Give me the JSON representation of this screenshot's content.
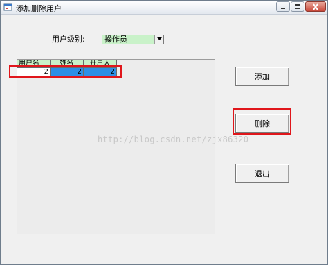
{
  "window": {
    "title": "添加删除用户"
  },
  "form": {
    "level_label": "用户级别:",
    "level_value": "操作员"
  },
  "grid": {
    "columns": [
      "用户名",
      "姓名",
      "开户人"
    ],
    "rows": [
      [
        "2",
        "2",
        "2"
      ]
    ]
  },
  "buttons": {
    "add": "添加",
    "delete": "删除",
    "exit": "退出"
  },
  "watermark": "http://blog.csdn.net/zjx86320",
  "colors": {
    "header_bg": "#c9f2c9",
    "selected_cell": "#2c8fe6",
    "highlight_box": "#e0161b"
  }
}
